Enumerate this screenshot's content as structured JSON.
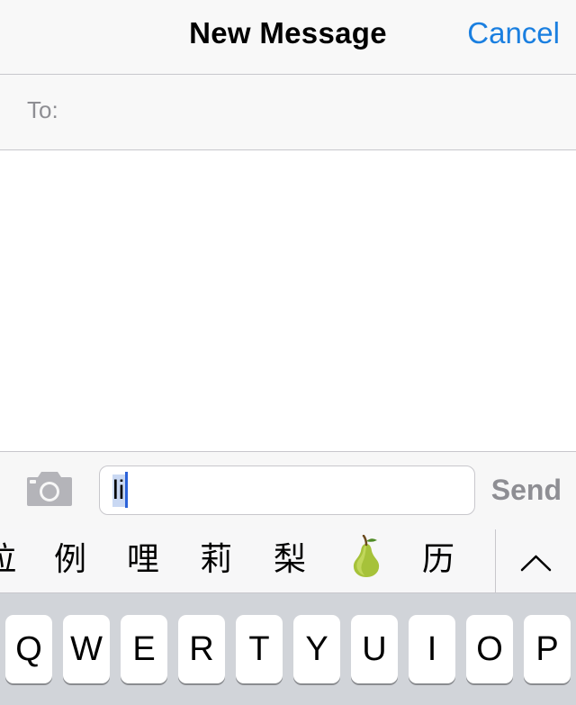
{
  "navbar": {
    "title": "New Message",
    "cancel_label": "Cancel"
  },
  "recipient": {
    "label": "To:",
    "value": ""
  },
  "compose": {
    "text": "li",
    "send_label": "Send",
    "camera_icon": "camera-icon"
  },
  "candidates": {
    "items": [
      "拉",
      "例",
      "哩",
      "莉",
      "梨",
      "🍐",
      "历"
    ],
    "expand_icon": "chevron-up-icon"
  },
  "keyboard": {
    "top_row": [
      "Q",
      "W",
      "E",
      "R",
      "T",
      "Y",
      "U",
      "I",
      "O",
      "P"
    ]
  },
  "colors": {
    "accent": "#1a7fe0",
    "send_disabled": "#8e8e93",
    "selection": "#c9d8f3",
    "caret": "#2b62d9",
    "keyboard_bg": "#d1d4d9"
  }
}
